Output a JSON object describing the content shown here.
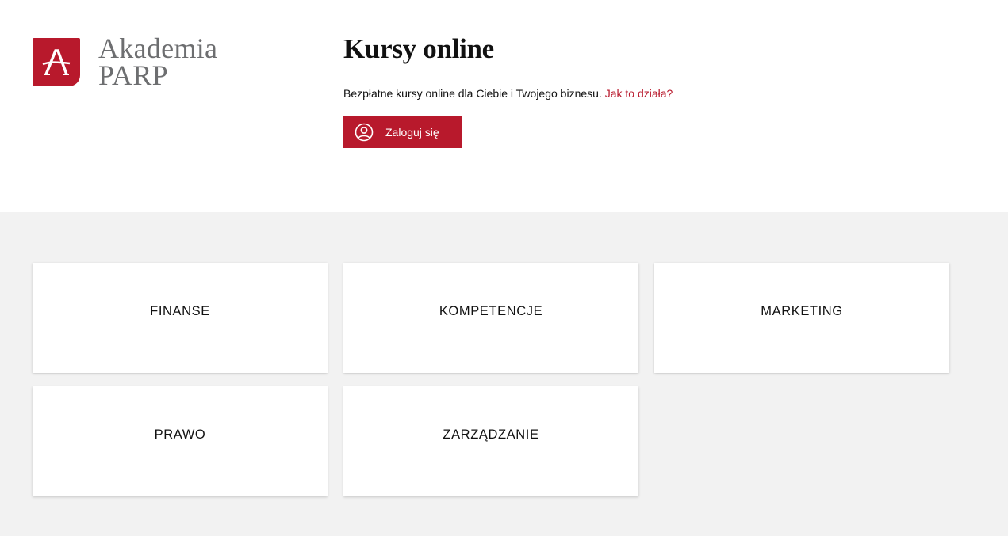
{
  "brand": {
    "line1": "Akademia",
    "line2": "PARP",
    "accent_color": "#b8192c"
  },
  "hero": {
    "title": "Kursy online",
    "lead_text": "Bezpłatne kursy online dla Ciebie i Twojego biznesu.",
    "lead_link": "Jak to działa?",
    "login_label": "Zaloguj się",
    "login_icon": "user-circle-icon"
  },
  "categories": [
    {
      "label": "FINANSE"
    },
    {
      "label": "KOMPETENCJE"
    },
    {
      "label": "MARKETING"
    },
    {
      "label": "PRAWO"
    },
    {
      "label": "ZARZĄDZANIE"
    }
  ]
}
